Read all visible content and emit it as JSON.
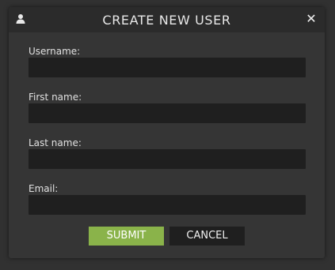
{
  "dialog": {
    "title": "CREATE NEW USER",
    "header_icon": "user-icon",
    "close_icon": "close-icon"
  },
  "form": {
    "fields": [
      {
        "label": "Username:",
        "value": "",
        "placeholder": ""
      },
      {
        "label": "First name:",
        "value": "",
        "placeholder": ""
      },
      {
        "label": "Last name:",
        "value": "",
        "placeholder": ""
      },
      {
        "label": "Email:",
        "value": "",
        "placeholder": ""
      }
    ]
  },
  "actions": {
    "submit_label": "SUBMIT",
    "cancel_label": "CANCEL"
  },
  "colors": {
    "accent": "#8ab34a",
    "background": "#353535",
    "titlebar": "#2b2b2b",
    "input": "#1f1f1f"
  }
}
